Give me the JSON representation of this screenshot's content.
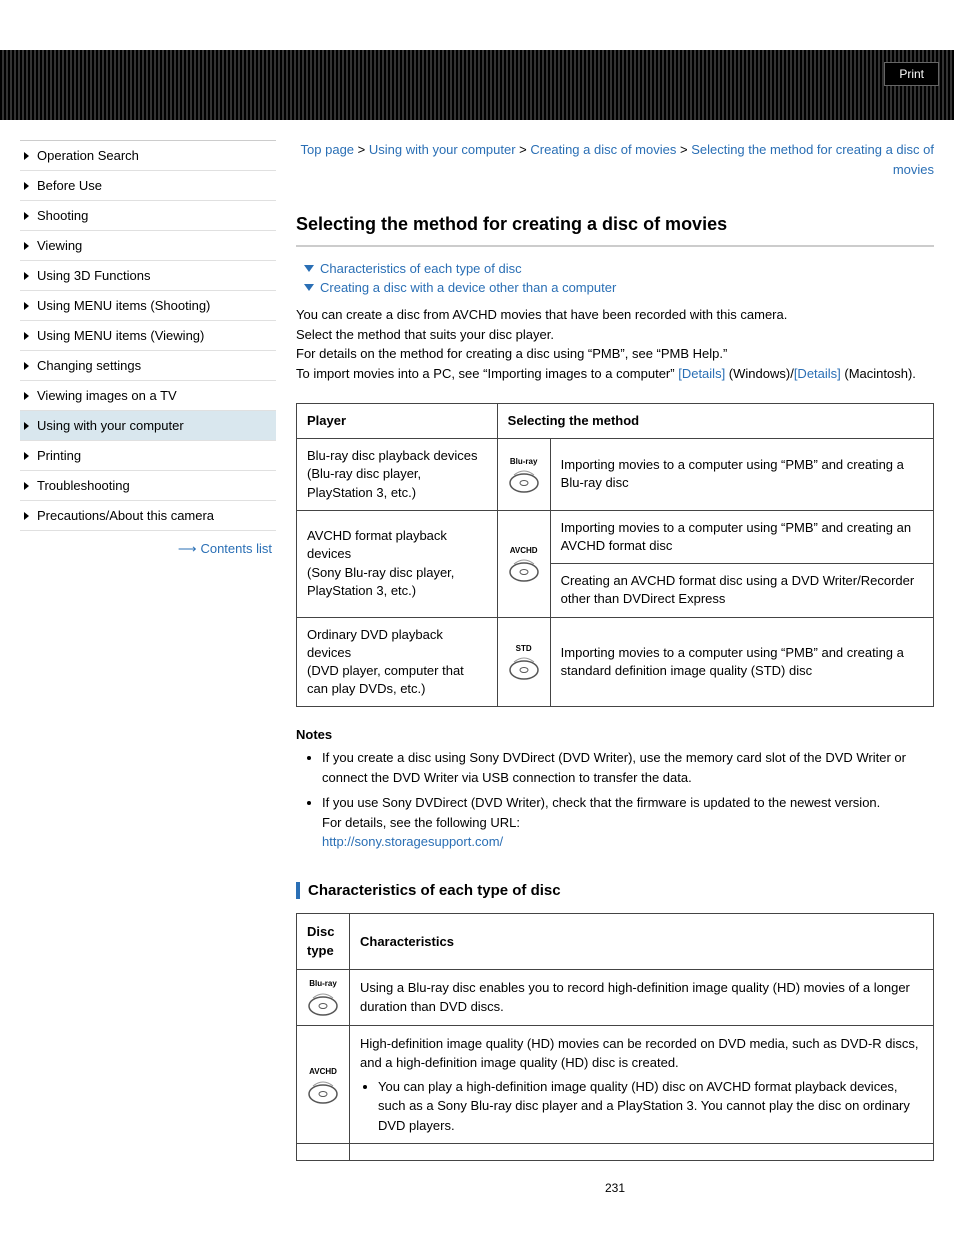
{
  "header": {
    "print": "Print"
  },
  "breadcrumb": {
    "top": "Top page",
    "l2": "Using with your computer",
    "l3": "Creating a disc of movies",
    "current": "Selecting the method for creating a disc of movies",
    "sep": ">"
  },
  "sidebar": {
    "items": [
      "Operation Search",
      "Before Use",
      "Shooting",
      "Viewing",
      "Using 3D Functions",
      "Using MENU items (Shooting)",
      "Using MENU items (Viewing)",
      "Changing settings",
      "Viewing images on a TV",
      "Using with your computer",
      "Printing",
      "Troubleshooting",
      "Precautions/About this camera"
    ],
    "active_index": 9,
    "contents_list": "Contents list"
  },
  "title": "Selecting the method for creating a disc of movies",
  "toc": {
    "link1": "Characteristics of each type of disc",
    "link2": "Creating a disc with a device other than a computer"
  },
  "intro": {
    "p1": "You can create a disc from AVCHD movies that have been recorded with this camera.",
    "p2": "Select the method that suits your disc player.",
    "p3": "For details on the method for creating a disc using “PMB”, see “PMB Help.”",
    "p4a": "To import movies into a PC, see “Importing images to a computer” ",
    "details1": "[Details]",
    "winpart": " (Windows)/",
    "details2": "[Details]",
    "p4b": " (Macintosh)."
  },
  "table1": {
    "h1": "Player",
    "h2": "Selecting the method",
    "icon1_label": "Blu-ray",
    "icon2_label": "AVCHD",
    "icon3_label": "STD",
    "row1_c1a": "Blu-ray disc playback devices",
    "row1_c1b": "(Blu-ray disc player, PlayStation 3, etc.)",
    "row1_c3": "Importing movies to a computer using “PMB” and creating a Blu-ray disc",
    "row2_c1a": "AVCHD format playback devices",
    "row2_c1b": "(Sony Blu-ray disc player, PlayStation 3, etc.)",
    "row2_c3a": "Importing movies to a computer using “PMB” and creating an AVCHD format disc",
    "row2_c3b": "Creating an AVCHD format disc using a DVD Writer/Recorder other than DVDirect Express",
    "row3_c1a": "Ordinary DVD playback devices",
    "row3_c1b": "(DVD player, computer that can play DVDs, etc.)",
    "row3_c3": "Importing movies to a computer using “PMB” and creating a standard definition image quality (STD) disc"
  },
  "notes": {
    "heading": "Notes",
    "n1": "If you create a disc using Sony DVDirect (DVD Writer), use the memory card slot of the DVD Writer or connect the DVD Writer via USB connection to transfer the data.",
    "n2a": "If you use Sony DVDirect (DVD Writer), check that the firmware is updated to the newest version.",
    "n2b": "For details, see the following URL:",
    "url": "http://sony.storagesupport.com/"
  },
  "section2": {
    "heading": "Characteristics of each type of disc",
    "h1": "Disc type",
    "h2": "Characteristics",
    "icon1_label": "Blu-ray",
    "icon2_label": "AVCHD",
    "r1": "Using a Blu-ray disc enables you to record high-definition image quality (HD) movies of a longer duration than DVD discs.",
    "r2a": "High-definition image quality (HD) movies can be recorded on DVD media, such as DVD-R discs, and a high-definition image quality (HD) disc is created.",
    "r2b": "You can play a high-definition image quality (HD) disc on AVCHD format playback devices, such as a Sony Blu-ray disc player and a PlayStation 3. You cannot play the disc on ordinary DVD players."
  },
  "page_num": "231"
}
